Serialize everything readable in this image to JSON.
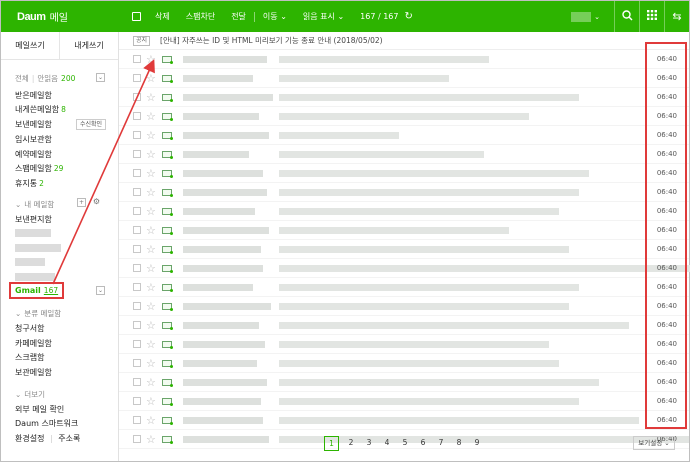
{
  "header": {
    "logo": "Daum",
    "app_name": "메일",
    "delete_label": "삭제",
    "spam_label": "스팸차단",
    "reply_label": "전달",
    "move_label": "이동",
    "readmark_label": "읽음 표시",
    "count": "167 / 167"
  },
  "sidebar": {
    "compose_label": "메일쓰기",
    "self_label": "내게쓰기",
    "all_label": "전체",
    "unread_label": "안읽음",
    "unread_count": "200",
    "folders": [
      {
        "label": "받은메일함",
        "count": ""
      },
      {
        "label": "내게쓴메일함",
        "count": "8"
      },
      {
        "label": "보낸메일함",
        "count": ""
      },
      {
        "label": "임시보관함",
        "count": ""
      },
      {
        "label": "예약메일함",
        "count": ""
      },
      {
        "label": "스팸메일함",
        "count": "29"
      },
      {
        "label": "휴지통",
        "count": "2"
      }
    ],
    "receipt_button": "수신확인",
    "my_folders_label": "내 메일함",
    "my_folder_first": "보낸편지함",
    "gmail_label": "Gmail",
    "gmail_count": "167",
    "category_label": "분류 메일함",
    "category_items": [
      "청구서함",
      "카페메일함",
      "스크랩함",
      "보관메일함"
    ],
    "more_label": "더보기",
    "more_items": [
      "외부 메일 확인",
      "Daum 스마트워크"
    ],
    "settings_label": "환경설정",
    "addressbook_label": "주소록"
  },
  "notice": {
    "tag": "공지",
    "text": "[안내] 자주쓰는 ID 및 HTML 미리보기 기능 종료 안내 (2018/05/02)"
  },
  "mail_time": "06:40",
  "mail_rows": [
    {
      "sender_w": 84,
      "subject_w": 210
    },
    {
      "sender_w": 70,
      "subject_w": 170
    },
    {
      "sender_w": 90,
      "subject_w": 300
    },
    {
      "sender_w": 76,
      "subject_w": 250
    },
    {
      "sender_w": 86,
      "subject_w": 120
    },
    {
      "sender_w": 66,
      "subject_w": 205
    },
    {
      "sender_w": 80,
      "subject_w": 310
    },
    {
      "sender_w": 84,
      "subject_w": 300
    },
    {
      "sender_w": 72,
      "subject_w": 280
    },
    {
      "sender_w": 86,
      "subject_w": 230
    },
    {
      "sender_w": 78,
      "subject_w": 290
    },
    {
      "sender_w": 80,
      "subject_w": 430
    },
    {
      "sender_w": 70,
      "subject_w": 300
    },
    {
      "sender_w": 88,
      "subject_w": 290
    },
    {
      "sender_w": 76,
      "subject_w": 350
    },
    {
      "sender_w": 82,
      "subject_w": 270
    },
    {
      "sender_w": 74,
      "subject_w": 280
    },
    {
      "sender_w": 84,
      "subject_w": 320
    },
    {
      "sender_w": 78,
      "subject_w": 300
    },
    {
      "sender_w": 80,
      "subject_w": 360
    },
    {
      "sender_w": 86,
      "subject_w": 410
    }
  ],
  "pages": [
    "1",
    "2",
    "3",
    "4",
    "5",
    "6",
    "7",
    "8",
    "9"
  ],
  "view_settings": "보기설정"
}
